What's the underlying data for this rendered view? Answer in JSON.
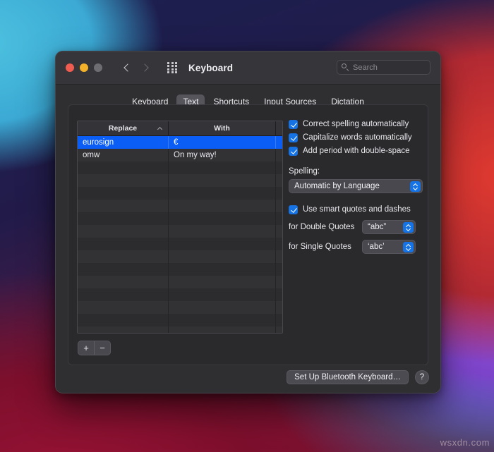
{
  "window": {
    "title": "Keyboard",
    "traffic_lights": [
      "close-red",
      "minimize-yellow",
      "zoom-gray"
    ],
    "nav_back_icon": "chevron-left-icon",
    "nav_forward_icon": "chevron-right-icon",
    "show_all_icon": "grid-dots-icon",
    "search": {
      "icon": "search-icon",
      "placeholder": "Search",
      "value": ""
    }
  },
  "tabs": [
    {
      "label": "Keyboard",
      "active": false
    },
    {
      "label": "Text",
      "active": true
    },
    {
      "label": "Shortcuts",
      "active": false
    },
    {
      "label": "Input Sources",
      "active": false
    },
    {
      "label": "Dictation",
      "active": false
    }
  ],
  "table": {
    "columns": [
      "Replace",
      "With",
      ""
    ],
    "sort_column": "Replace",
    "sort_direction": "ascending",
    "sort_icon": "chevron-up-icon",
    "rows": [
      {
        "replace": "eurosign",
        "with": "€",
        "selected": true
      },
      {
        "replace": "omw",
        "with": "On my way!",
        "selected": false
      }
    ],
    "empty_row_count": 14
  },
  "table_controls": {
    "add_label": "+",
    "remove_label": "−",
    "add_icon": "plus-icon",
    "remove_icon": "minus-icon"
  },
  "options": {
    "checkboxes": [
      {
        "label": "Correct spelling automatically",
        "checked": true
      },
      {
        "label": "Capitalize words automatically",
        "checked": true
      },
      {
        "label": "Add period with double-space",
        "checked": true
      }
    ],
    "spelling": {
      "label": "Spelling:",
      "value": "Automatic by Language"
    },
    "smart_quotes": {
      "label": "Use smart quotes and dashes",
      "checked": true
    },
    "double_quotes": {
      "label": "for Double Quotes",
      "value": "“abc”"
    },
    "single_quotes": {
      "label": "for Single Quotes",
      "value": "‘abc’"
    }
  },
  "footer": {
    "bluetooth_button": "Set Up Bluetooth Keyboard…",
    "help_button": "?"
  },
  "watermark": "wsxdn.com",
  "colors": {
    "selection_blue": "#0b5ef5",
    "accent_blue": "#1673e6",
    "window_bg": "#2f2f31",
    "panel_bg": "#2a2a2c",
    "titlebar_bg": "#35353a"
  }
}
